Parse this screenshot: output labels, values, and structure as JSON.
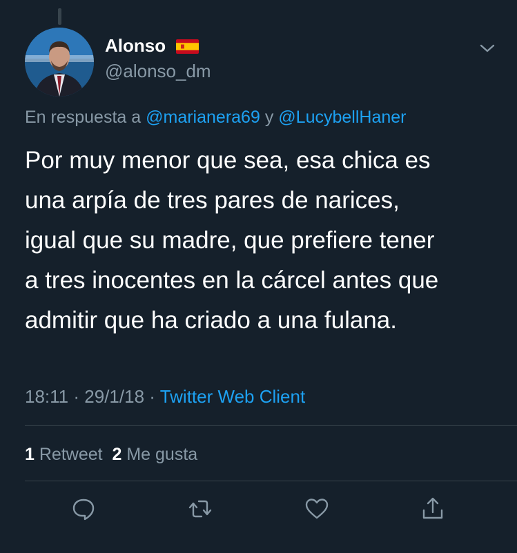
{
  "author": {
    "name": "Alonso",
    "flag_icon": "spain-flag-icon",
    "handle": "@alonso_dm"
  },
  "reply": {
    "prefix": "En respuesta a",
    "mention1": "@marianera69",
    "conjunction": "y",
    "mention2": "@LucybellHaner"
  },
  "tweet": {
    "text": "Por muy menor que sea, esa chica es\nuna arpía de tres pares de narices,\nigual que su madre, que prefiere tener\na tres inocentes en la cárcel antes que\nadmitir que ha criado a una fulana."
  },
  "meta": {
    "time": "18:11",
    "sep1": "·",
    "date": "29/1/18",
    "sep2": "·",
    "client": "Twitter Web Client"
  },
  "stats": {
    "retweets_count": "1",
    "retweets_label": "Retweet",
    "likes_count": "2",
    "likes_label": "Me gusta"
  },
  "actions": [
    {
      "icon": "reply-icon"
    },
    {
      "icon": "retweet-icon"
    },
    {
      "icon": "like-icon"
    },
    {
      "icon": "share-icon"
    }
  ],
  "colors": {
    "background": "#15202b",
    "text": "#ffffff",
    "secondary": "#8899a6",
    "accent": "#1da1f2",
    "divider": "#38444d"
  }
}
